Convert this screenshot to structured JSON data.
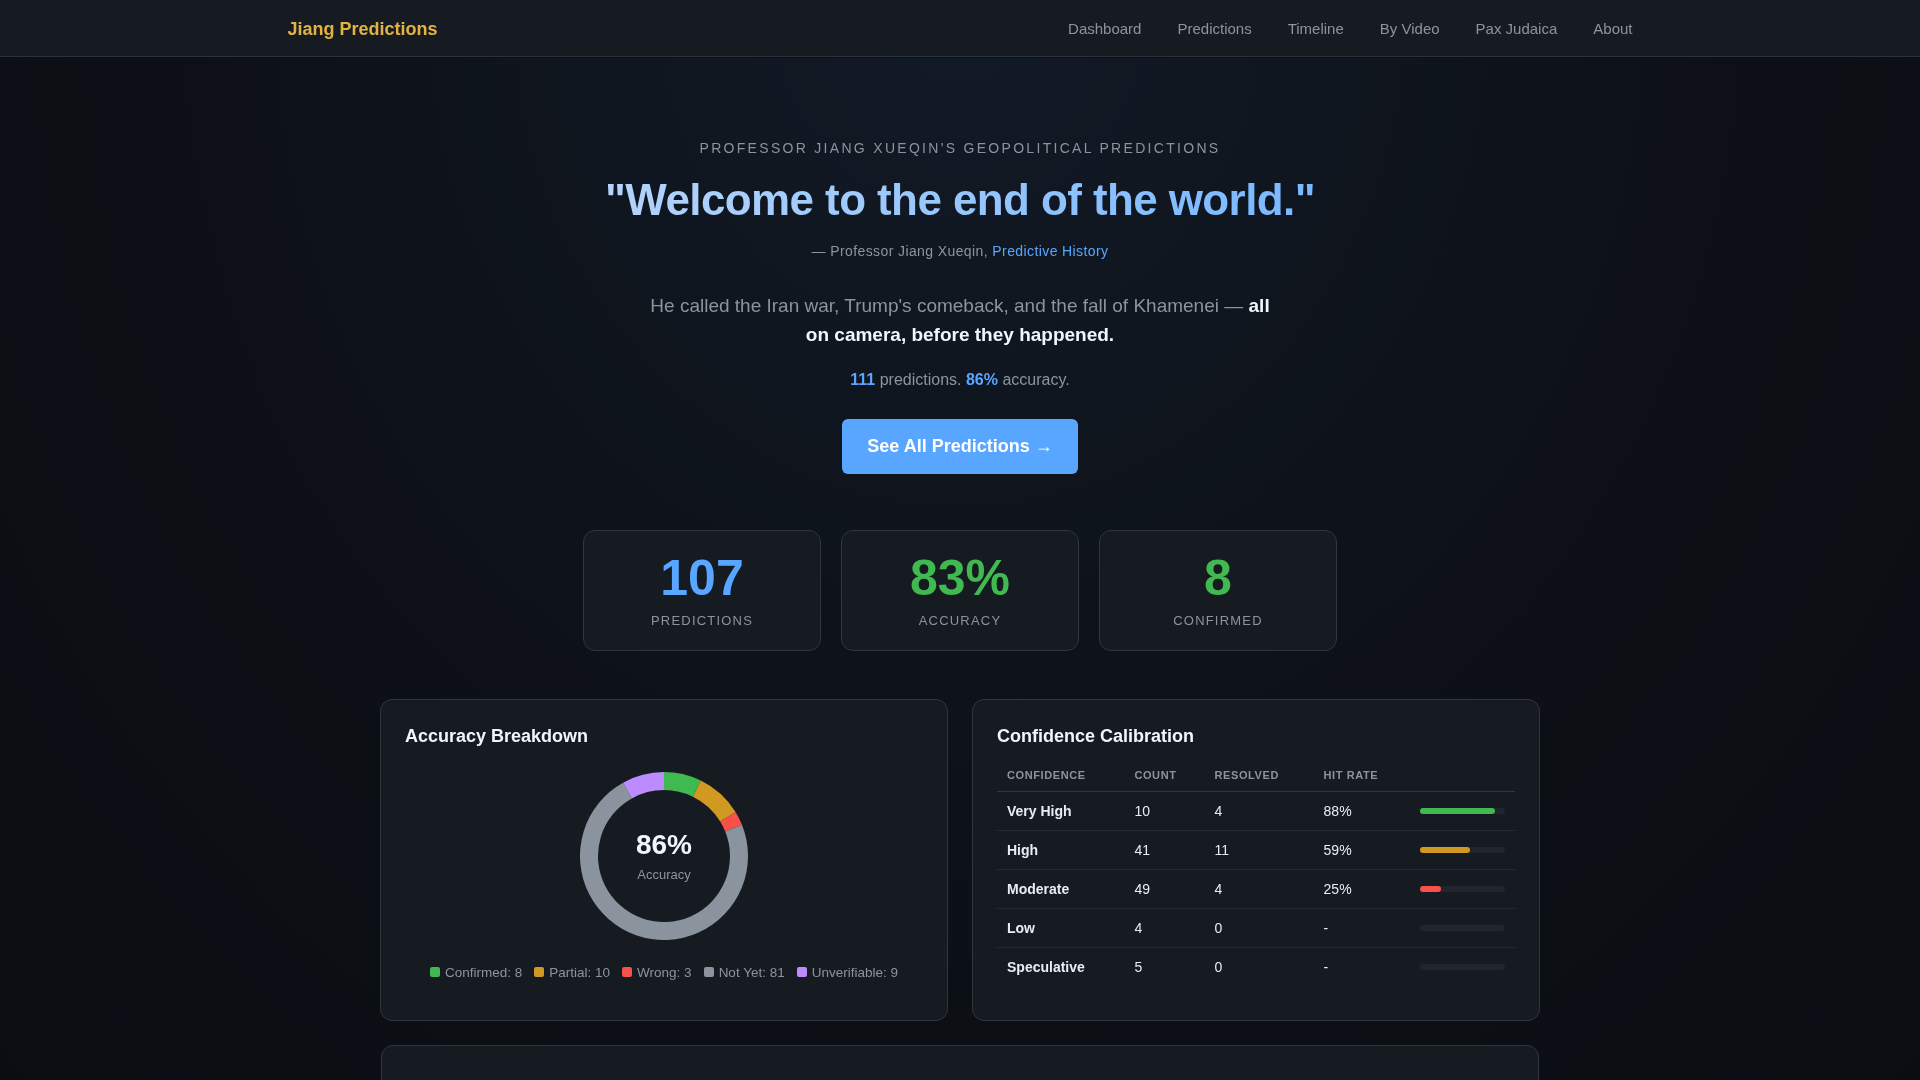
{
  "nav": {
    "brand": "Jiang Predictions",
    "links": [
      "Dashboard",
      "Predictions",
      "Timeline",
      "By Video",
      "Pax Judaica",
      "About"
    ]
  },
  "hero": {
    "eyebrow": "PROFESSOR JIANG XUEQIN'S GEOPOLITICAL PREDICTIONS",
    "quote": "\"Welcome to the end of the world.\"",
    "attribution": "— Professor Jiang Xueqin, ",
    "source_link": "Predictive History",
    "description": "He called the Iran war, Trump's comeback, and the fall of Khamenei — **all on camera, before they happened.**",
    "stats_line": "**111** predictions. **86%** accuracy.",
    "cta": "See All Predictions →"
  },
  "stats": [
    {
      "value": "107",
      "label": "PREDICTIONS",
      "color": "#58a6ff"
    },
    {
      "value": "83%",
      "label": "ACCURACY",
      "color": "#3fb950"
    },
    {
      "value": "8",
      "label": "CONFIRMED",
      "color": "#3fb950"
    }
  ],
  "accuracy_breakdown": {
    "title": "Accuracy Breakdown",
    "center_value": "86%",
    "center_label": "Accuracy",
    "chart_data": {
      "type": "donut",
      "categories": [
        "Confirmed: 8",
        "Partial: 10",
        "Wrong: 3",
        "Not Yet: 81",
        "Unverifiable: 9"
      ],
      "values": [
        8,
        10,
        3,
        81,
        9
      ]
    },
    "legend": [
      {
        "color": "#3fb950"
      },
      {
        "color": "#d29922"
      },
      {
        "color": "#f85149"
      },
      {
        "color": "#8b949e"
      },
      {
        "color": "#bc8cff"
      }
    ]
  },
  "calibration": {
    "title": "Confidence Calibration",
    "columns": [
      "CONFIDENCE",
      "COUNT",
      "RESOLVED",
      "HIT RATE"
    ],
    "rows": [
      {
        "confidence": "Very High",
        "count": "10",
        "resolved": "4",
        "hit_rate": "88%",
        "level": 0.88,
        "color": "#3fb950"
      },
      {
        "confidence": "High",
        "count": "41",
        "resolved": "11",
        "hit_rate": "59%",
        "level": 0.59,
        "color": "#d29922"
      },
      {
        "confidence": "Moderate",
        "count": "49",
        "resolved": "4",
        "hit_rate": "25%",
        "level": 0.25,
        "color": "#f85149"
      },
      {
        "confidence": "Low",
        "count": "4",
        "resolved": "0",
        "hit_rate": "-"
      },
      {
        "confidence": "Speculative",
        "count": "5",
        "resolved": "0",
        "hit_rate": "-"
      }
    ]
  }
}
